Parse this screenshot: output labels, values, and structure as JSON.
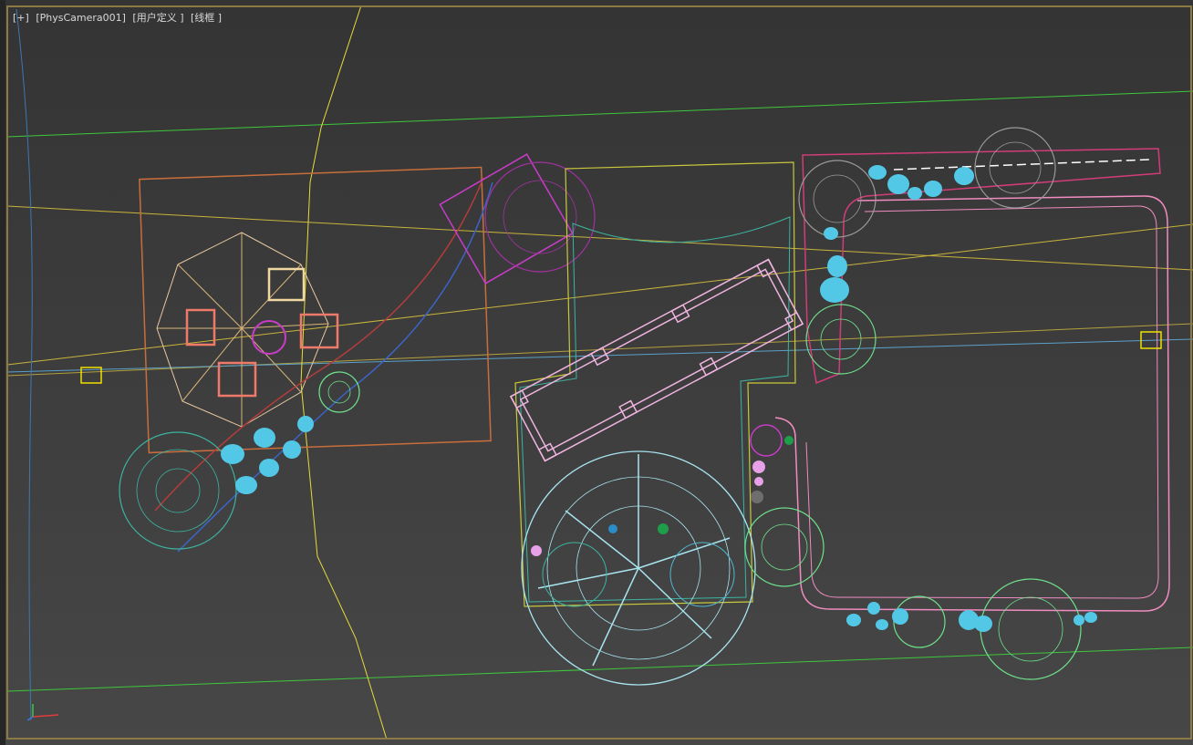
{
  "viewport": {
    "menu_plus": "[+]",
    "camera": "[PhysCamera001]",
    "view_mode": "[用户定义 ]",
    "shading": "[线框 ]"
  },
  "colors": {
    "frame": "#8c7a45",
    "wire_green": "#6ee08c",
    "wire_cyan": "#7de0f0",
    "wire_pink": "#f08cc0",
    "wire_magenta": "#c83cc8",
    "wire_yellow": "#e6dc3c",
    "wire_orange": "#c86e3c",
    "wire_grey": "#9a9a9a",
    "wire_teal": "#3cb4a0",
    "bush_fill": "#52c8e6"
  },
  "icons": {
    "camera_target": "yellow-box-icon",
    "axis": "axis-tripod-icon"
  }
}
